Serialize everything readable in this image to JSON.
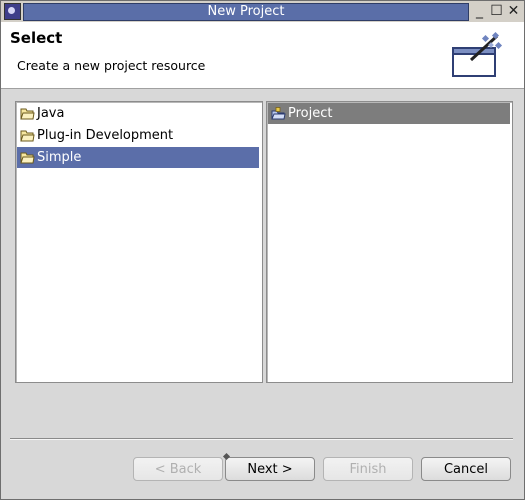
{
  "window": {
    "title": "New Project",
    "icon": "eclipse-app-icon",
    "controls": [
      "minimize-icon",
      "maximize-icon",
      "close-icon"
    ]
  },
  "header": {
    "title": "Select",
    "description": "Create a new project resource",
    "icon": "new-project-wizard-icon"
  },
  "left_list": {
    "items": [
      {
        "label": "Java",
        "icon": "folder-icon",
        "selected": false
      },
      {
        "label": "Plug-in Development",
        "icon": "folder-icon",
        "selected": false
      },
      {
        "label": "Simple",
        "icon": "folder-icon",
        "selected": true
      }
    ]
  },
  "right_list": {
    "items": [
      {
        "label": "Project",
        "icon": "project-icon",
        "selected": true
      }
    ]
  },
  "buttons": {
    "back": "< Back",
    "next": "Next >",
    "finish": "Finish",
    "cancel": "Cancel"
  },
  "colors": {
    "title_bar": "#5a6ea8",
    "selection_active": "#5b6ea9",
    "selection_inactive": "#7d7d7d"
  }
}
